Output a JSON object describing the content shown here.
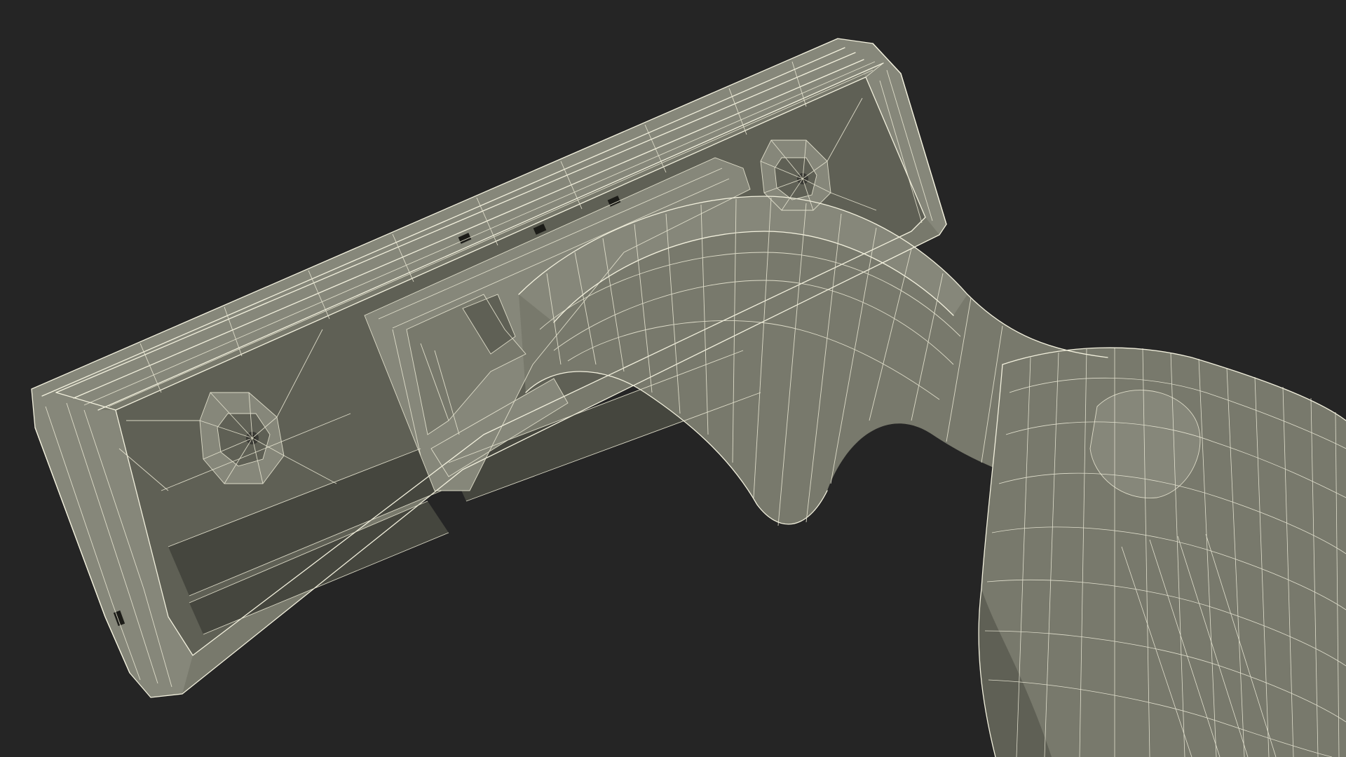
{
  "scene": {
    "subject": "razor",
    "render_style": "wireframe-over-shaded",
    "colors": {
      "background": "#252525",
      "surface": "#78796c",
      "surface_shadow": "#5f6055",
      "wire": "#f3f1de"
    }
  }
}
